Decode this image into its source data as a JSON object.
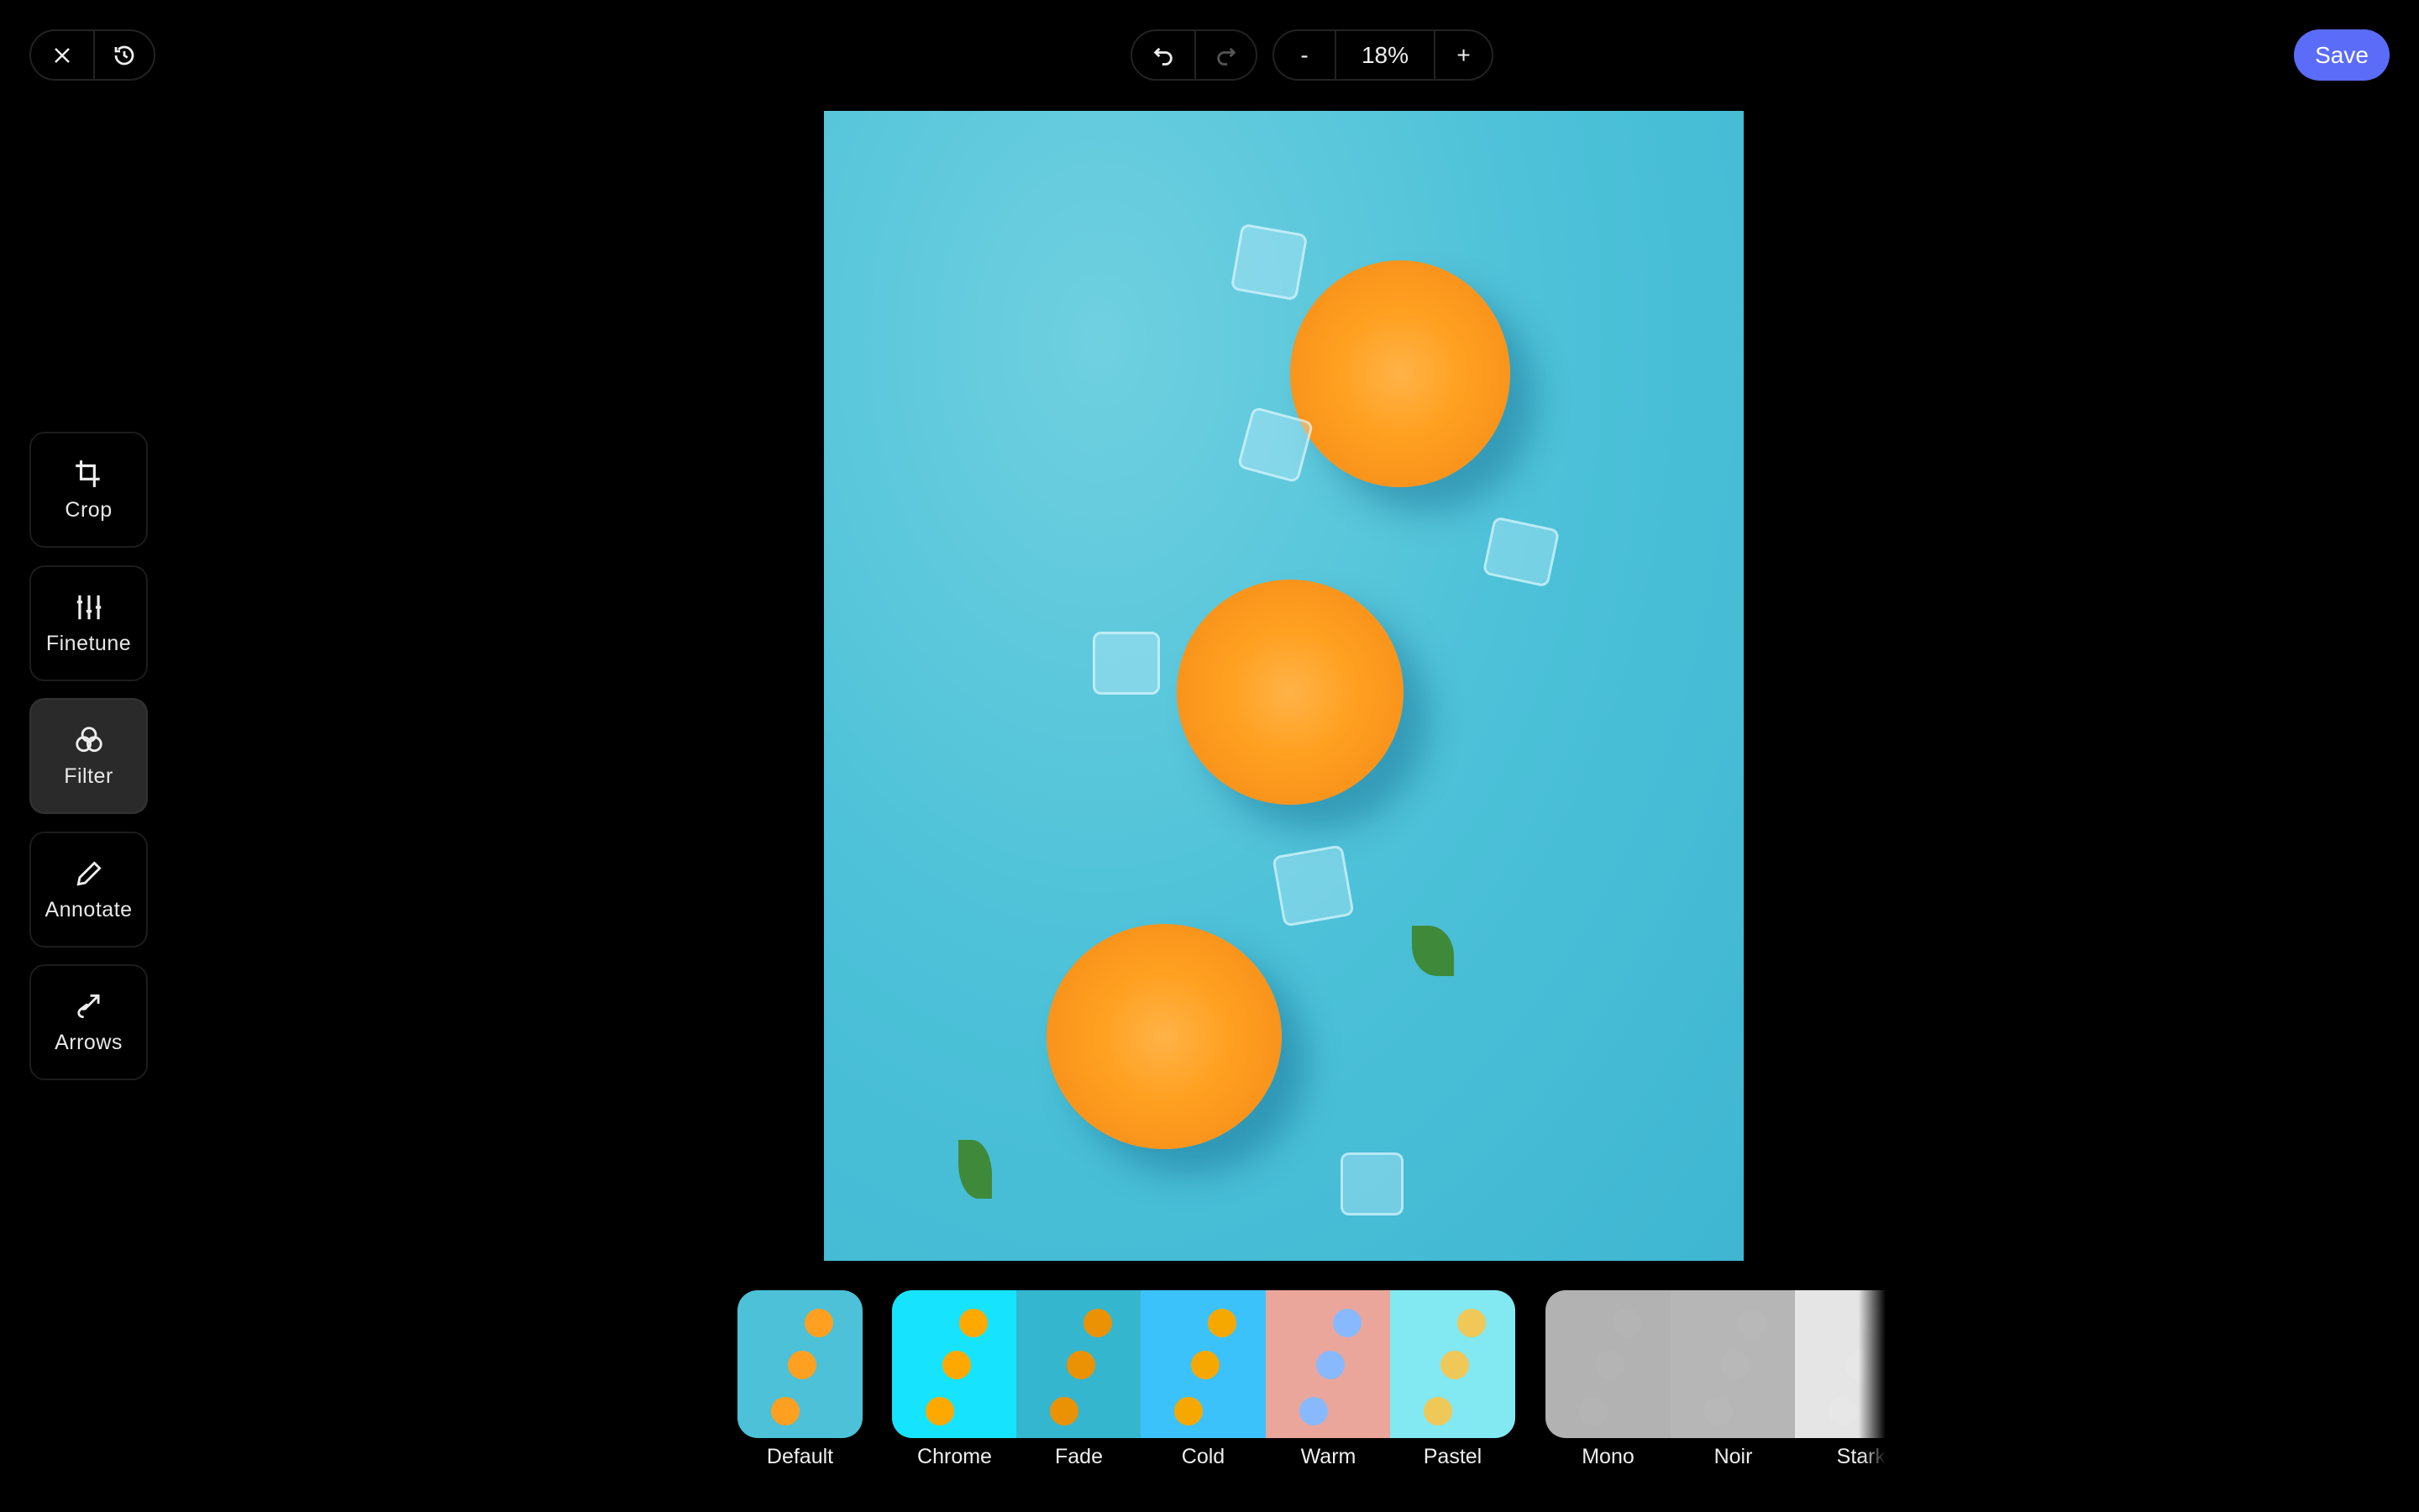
{
  "toolbar": {
    "close_icon": "close-icon",
    "history_icon": "history-icon",
    "undo_icon": "undo-icon",
    "redo_icon": "redo-icon",
    "zoom_out": "-",
    "zoom_level": "18%",
    "zoom_in": "+",
    "save_label": "Save",
    "accent": "#5b6cf9"
  },
  "tools": [
    {
      "label": "Crop",
      "icon": "crop-icon"
    },
    {
      "label": "Finetune",
      "icon": "sliders-icon"
    },
    {
      "label": "Filter",
      "icon": "filter-circles-icon",
      "active": true
    },
    {
      "label": "Annotate",
      "icon": "pencil-icon"
    },
    {
      "label": "Arrows",
      "icon": "arrow-icon"
    }
  ],
  "filters": [
    {
      "label": "Default",
      "selected": true
    },
    {
      "label": "Chrome"
    },
    {
      "label": "Fade"
    },
    {
      "label": "Cold"
    },
    {
      "label": "Warm"
    },
    {
      "label": "Pastel"
    },
    {
      "label": "Mono"
    },
    {
      "label": "Noir"
    },
    {
      "label": "Stark"
    }
  ]
}
